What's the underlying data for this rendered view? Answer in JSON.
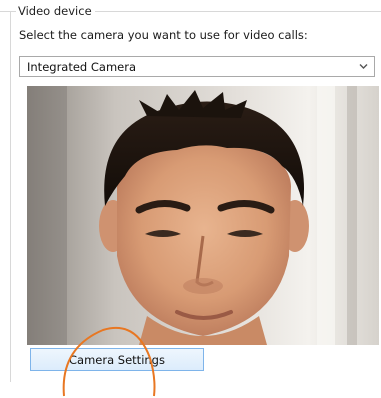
{
  "video_device": {
    "group_label": "Video device",
    "prompt": "Select the camera you want to use for video calls:",
    "selected_camera": "Integrated Camera",
    "dropdown_icon": "chevron-down-icon",
    "camera_settings_label": "Camera Settings"
  },
  "colors": {
    "highlight_ring": "#e87722",
    "button_border": "#7eb4ea",
    "button_fill": "#dcecfc"
  }
}
